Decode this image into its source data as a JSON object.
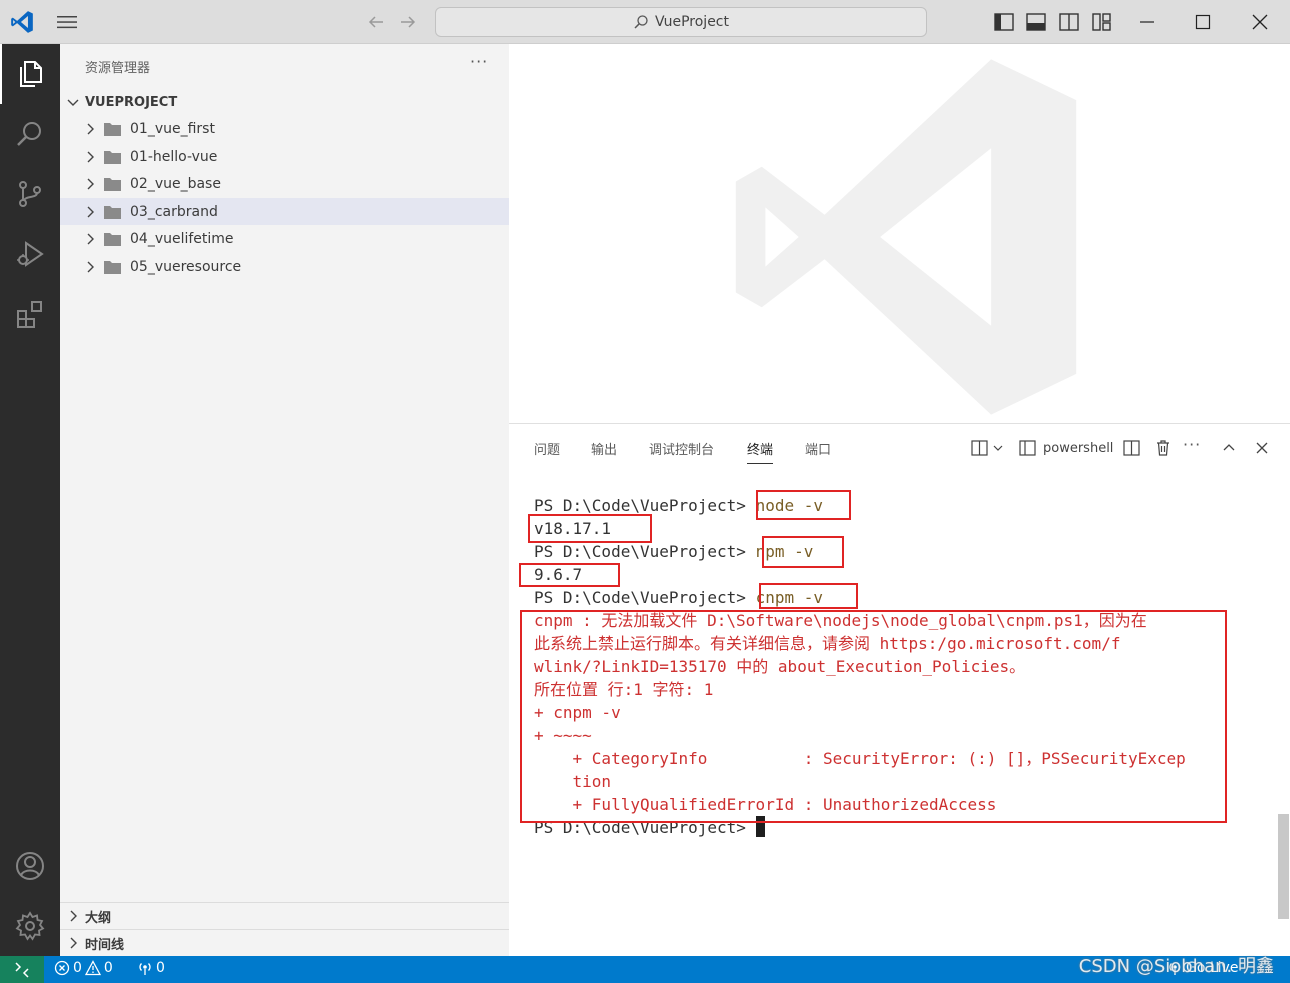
{
  "window": {
    "search_title": "VueProject"
  },
  "sidebar": {
    "title": "资源管理器",
    "more": "···",
    "root": "VUEPROJECT",
    "items": [
      {
        "label": "01_vue_first"
      },
      {
        "label": "01-hello-vue"
      },
      {
        "label": "02_vue_base"
      },
      {
        "label": "03_carbrand"
      },
      {
        "label": "04_vuelifetime"
      },
      {
        "label": "05_vueresource"
      }
    ],
    "outline": "大纲",
    "timeline": "时间线"
  },
  "panel": {
    "tabs": [
      "问题",
      "输出",
      "调试控制台",
      "终端",
      "端口"
    ],
    "active_tab": "终端",
    "shell": "powershell"
  },
  "terminal": {
    "prompt": "PS D:\\Code\\VueProject> ",
    "cmd1": "node -v",
    "out1": "v18.17.1",
    "cmd2": "npm -v",
    "out2": "9.6.7",
    "cmd3": "cnpm -v",
    "err": [
      "cnpm : 无法加载文件 D:\\Software\\nodejs\\node_global\\cnpm.ps1，因为在",
      "此系统上禁止运行脚本。有关详细信息，请参阅 https:/go.microsoft.com/f",
      "wlink/?LinkID=135170 中的 about_Execution_Policies。",
      "所在位置 行:1 字符: 1",
      "+ cnpm -v",
      "+ ~~~~",
      "    + CategoryInfo          : SecurityError: (:) []，PSSecurityExcep",
      "    tion",
      "    + FullyQualifiedErrorId : UnauthorizedAccess"
    ],
    "final_prompt": "PS D:\\Code\\VueProject> "
  },
  "status": {
    "errors": "0",
    "warnings": "0",
    "ports": "0",
    "golive": "Go Live",
    "credit": "CSDN @Siobhan. 明鑫"
  },
  "colors": {
    "activity_bar": "#2c2c2c",
    "sidebar": "#f3f3f3",
    "status_bar": "#007acc",
    "remote": "#16825d",
    "error_text": "#cd3131",
    "highlight_box": "#e02424"
  }
}
